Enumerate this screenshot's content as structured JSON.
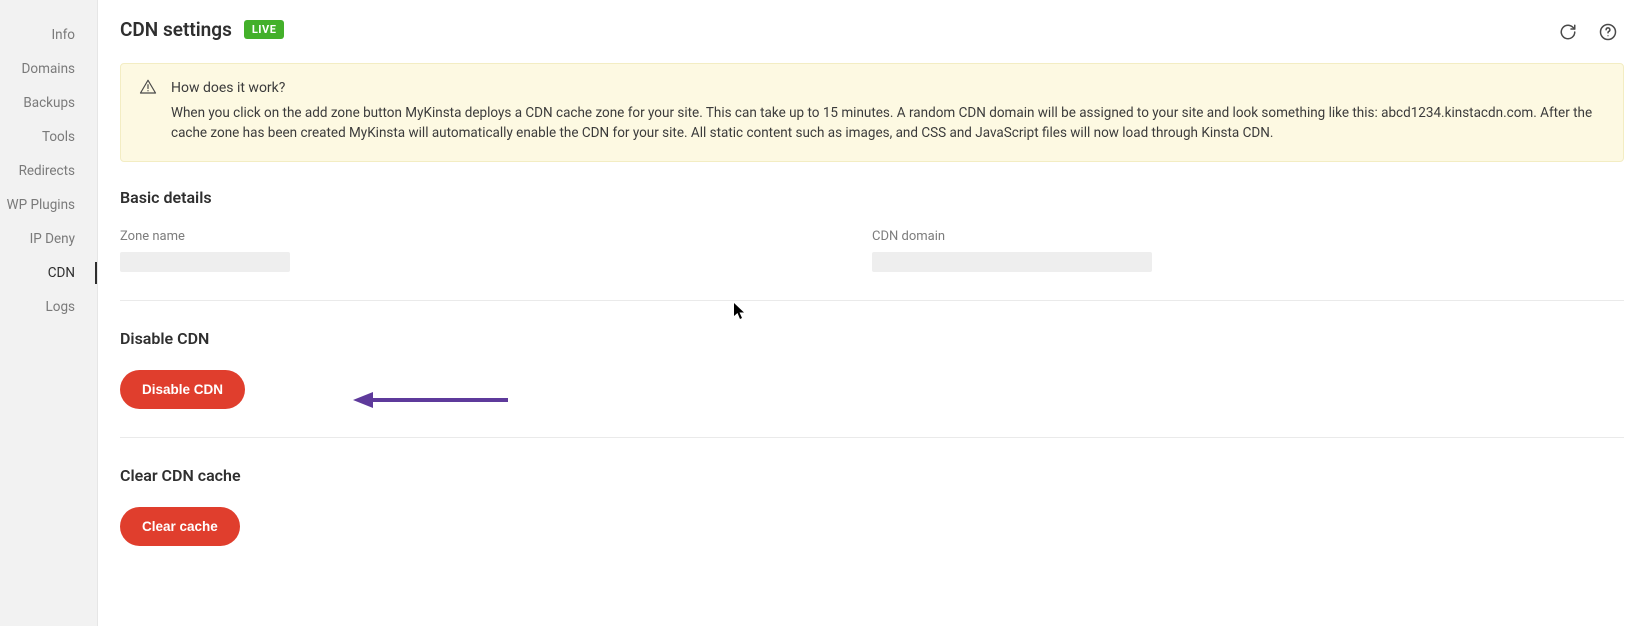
{
  "sidebar": {
    "items": [
      {
        "label": "Info"
      },
      {
        "label": "Domains"
      },
      {
        "label": "Backups"
      },
      {
        "label": "Tools"
      },
      {
        "label": "Redirects"
      },
      {
        "label": "WP Plugins"
      },
      {
        "label": "IP Deny"
      },
      {
        "label": "CDN"
      },
      {
        "label": "Logs"
      }
    ],
    "active_index": 7
  },
  "header": {
    "title": "CDN settings",
    "badge": "LIVE"
  },
  "info_panel": {
    "title": "How does it work?",
    "body": "When you click on the add zone button MyKinsta deploys a CDN cache zone for your site. This can take up to 15 minutes. A random CDN domain will be assigned to your site and look something like this: abcd1234.kinstacdn.com. After the cache zone has been created MyKinsta will automatically enable the CDN for your site. All static content such as images, and CSS and JavaScript files will now load through Kinsta CDN."
  },
  "basic_details": {
    "heading": "Basic details",
    "zone_label": "Zone name",
    "zone_value": "",
    "domain_label": "CDN domain",
    "domain_value": ""
  },
  "disable_cdn": {
    "heading": "Disable CDN",
    "button": "Disable CDN"
  },
  "clear_cache": {
    "heading": "Clear CDN cache",
    "button": "Clear cache"
  },
  "colors": {
    "accent_red": "#e03e2d",
    "badge_green": "#43b02a",
    "panel_yellow": "#fdf9e2",
    "annotation_purple": "#5e3a9b"
  }
}
